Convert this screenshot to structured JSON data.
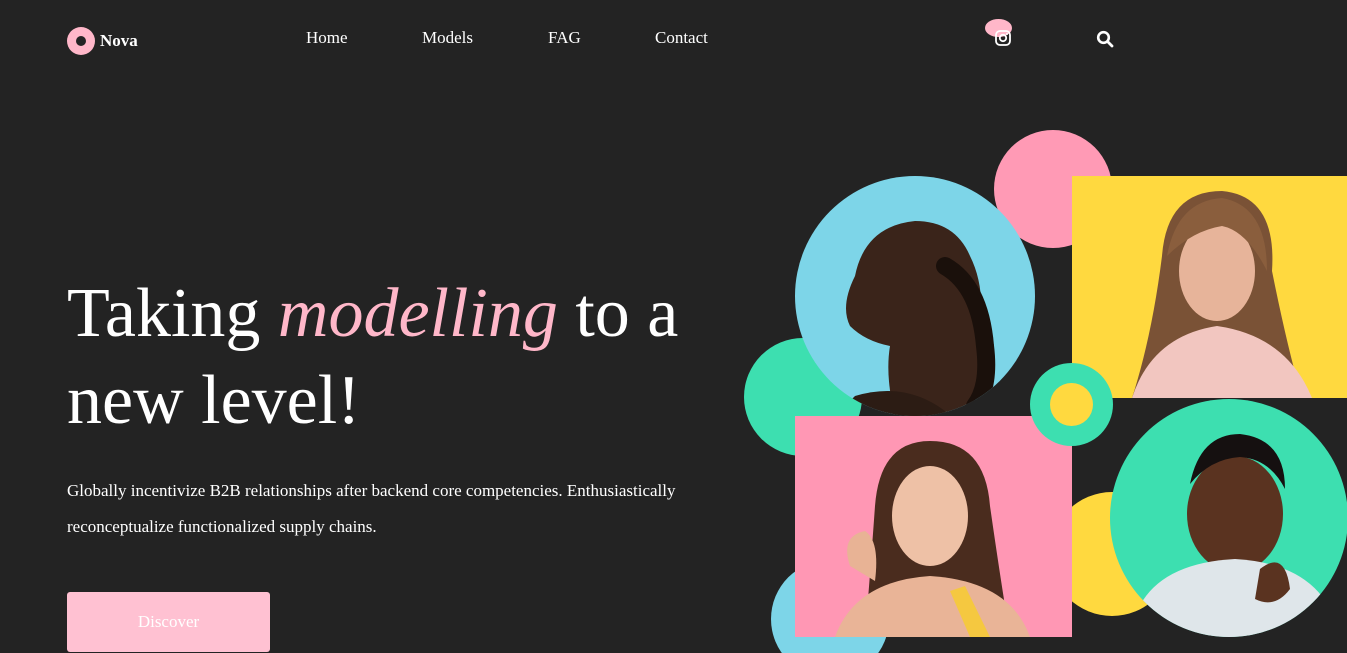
{
  "brand": {
    "name": "Nova"
  },
  "nav": {
    "items": [
      {
        "label": "Home"
      },
      {
        "label": "Models"
      },
      {
        "label": "FAG"
      },
      {
        "label": "Contact"
      }
    ],
    "icons": [
      "instagram-icon",
      "search-icon"
    ]
  },
  "hero": {
    "headline_before": "Taking ",
    "headline_accent": "modelling",
    "headline_after": " to a new level!",
    "description": "Globally incentivize B2B relationships after backend core competencies. Enthusiastically reconceptualize functionalized supply chains.",
    "cta_label": "Discover"
  },
  "colors": {
    "background": "#232323",
    "pink": "#ffb7c9",
    "blue": "#7dd5e8",
    "yellow": "#ffd93f",
    "green": "#3ddfb0"
  }
}
